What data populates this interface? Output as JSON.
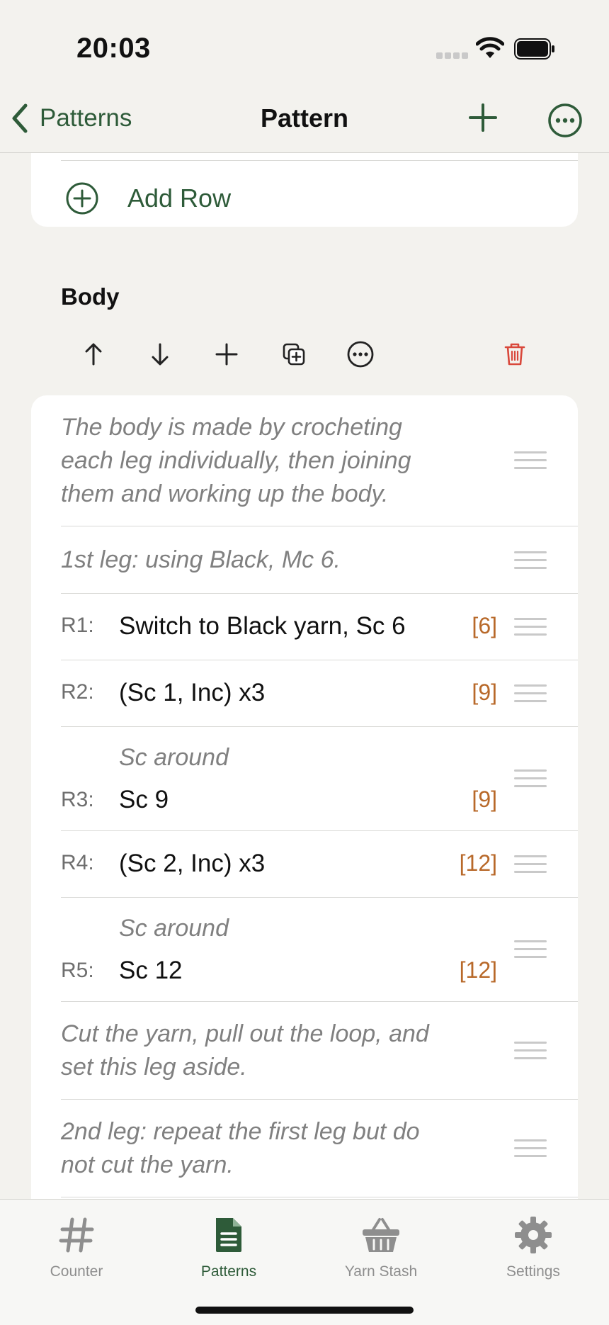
{
  "status_bar": {
    "time": "20:03"
  },
  "navbar": {
    "back_label": "Patterns",
    "title": "Pattern"
  },
  "add_row": {
    "label": "Add Row"
  },
  "section": {
    "title": "Body",
    "rows": [
      {
        "kind": "note",
        "text": "The body is made by crocheting each leg individually, then joining them and working up the body."
      },
      {
        "kind": "note",
        "text": "1st leg: using Black, Mc 6."
      },
      {
        "kind": "row",
        "num": "R1:",
        "text": "Switch to Black yarn, Sc 6",
        "count": "[6]"
      },
      {
        "kind": "row",
        "num": "R2:",
        "text": "(Sc 1, Inc) x3",
        "count": "[9]"
      },
      {
        "kind": "row",
        "num": "R3:",
        "sub": "Sc around",
        "text": "Sc 9",
        "count": "[9]"
      },
      {
        "kind": "row",
        "num": "R4:",
        "text": "(Sc 2, Inc) x3",
        "count": "[12]"
      },
      {
        "kind": "row",
        "num": "R5:",
        "sub": "Sc around",
        "text": "Sc 12",
        "count": "[12]"
      },
      {
        "kind": "note",
        "text": "Cut the yarn, pull out the loop, and set this leg aside."
      },
      {
        "kind": "note",
        "text": "2nd leg: repeat the first leg but do not cut the yarn."
      }
    ]
  },
  "tabbar": {
    "tabs": [
      {
        "label": "Counter",
        "icon": "hash-icon"
      },
      {
        "label": "Patterns",
        "icon": "document-icon",
        "active": true
      },
      {
        "label": "Yarn Stash",
        "icon": "basket-icon"
      },
      {
        "label": "Settings",
        "icon": "gear-icon"
      }
    ]
  },
  "colors": {
    "accent": "#2e5b39",
    "count": "#b8692a",
    "delete": "#d9483b",
    "background": "#f3f2ee"
  }
}
